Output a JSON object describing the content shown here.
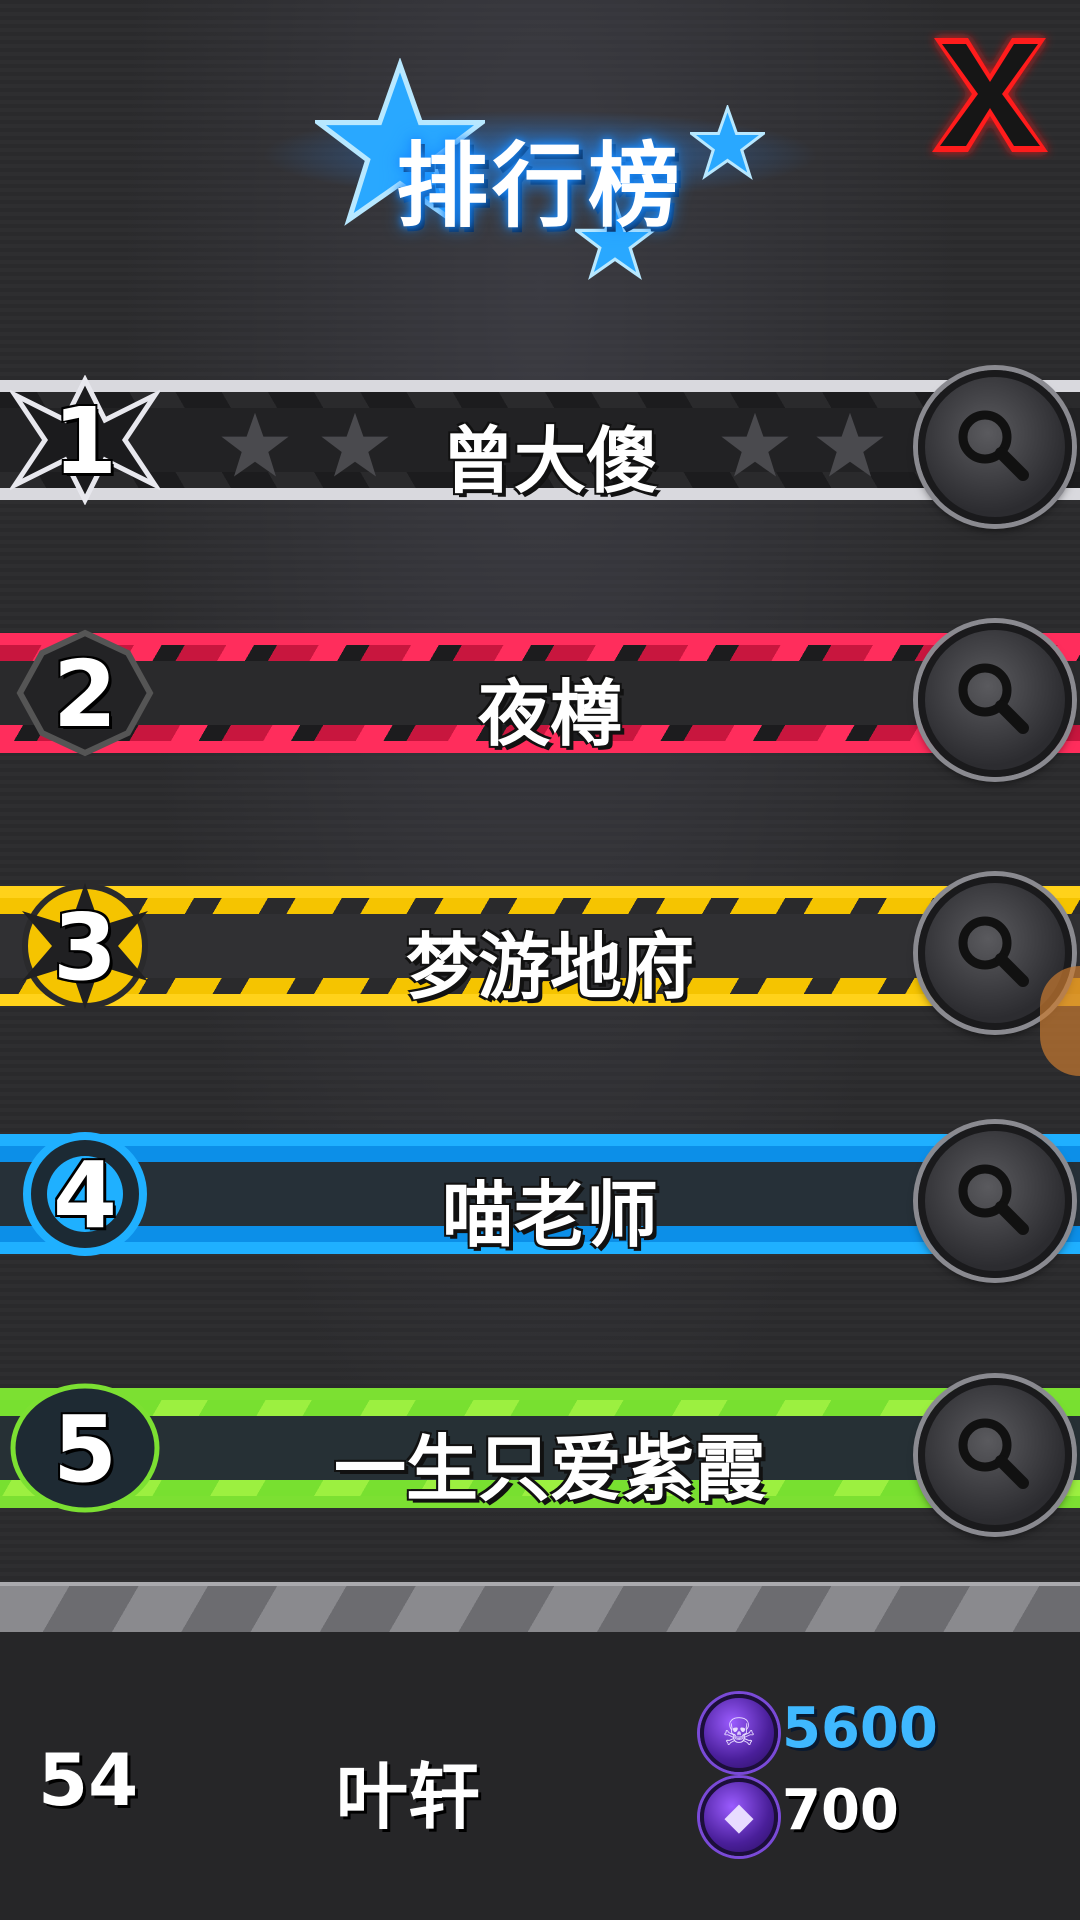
{
  "header": {
    "title": "排行榜",
    "close_icon": "close-x-icon",
    "accent_color": "#1a8cff",
    "close_color": "#ff1a1a"
  },
  "leaderboard": [
    {
      "rank": "1",
      "name": "曾大傻",
      "theme": "silver",
      "action_icon": "search-icon"
    },
    {
      "rank": "2",
      "name": "夜樽",
      "theme": "red",
      "action_icon": "search-icon"
    },
    {
      "rank": "3",
      "name": "梦游地府",
      "theme": "yellow",
      "action_icon": "search-icon"
    },
    {
      "rank": "4",
      "name": "喵老师",
      "theme": "blue",
      "action_icon": "search-icon"
    },
    {
      "rank": "5",
      "name": "一生只爱紫霞",
      "theme": "green",
      "action_icon": "search-icon"
    }
  ],
  "my_entry": {
    "rank": "54",
    "name": "叶轩",
    "currency_1": {
      "icon": "purple-skull-coin-icon",
      "value": "5600",
      "color": "#3fb8ff"
    },
    "currency_2": {
      "icon": "purple-gem-coin-icon",
      "value": "700",
      "color": "#ffffff"
    }
  }
}
